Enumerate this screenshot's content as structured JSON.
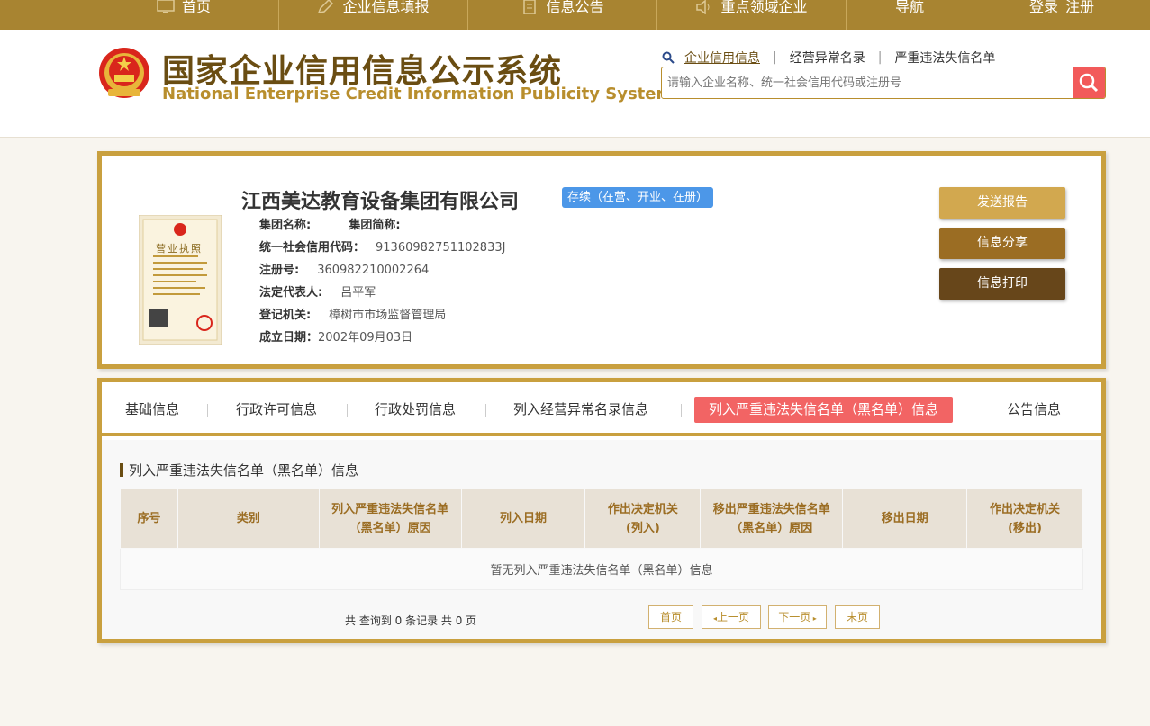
{
  "topnav": {
    "items": [
      {
        "label": "首页",
        "icon": "monitor-icon"
      },
      {
        "label": "企业信息填报",
        "icon": "edit-icon"
      },
      {
        "label": "信息公告",
        "icon": "document-icon"
      },
      {
        "label": "重点领域企业",
        "icon": "speaker-icon"
      },
      {
        "label": "导航",
        "icon": ""
      },
      {
        "label": "登录",
        "icon": ""
      },
      {
        "label": "注册",
        "icon": ""
      }
    ]
  },
  "header": {
    "title_cn": "国家企业信用信息公示系统",
    "title_en": "National Enterprise Credit Information Publicity System",
    "search_tabs": [
      "企业信用信息",
      "经营异常名录",
      "严重违法失信名单"
    ],
    "search_placeholder": "请输入企业名称、统一社会信用代码或注册号"
  },
  "company": {
    "name": "江西美达教育设备集团有限公司",
    "status": "存续（在营、开业、在册）",
    "license_label": "营业执照",
    "fields": [
      {
        "label": "集团名称:",
        "value": "",
        "label2": "集团简称:"
      },
      {
        "label": "统一社会信用代码：",
        "value": "91360982751102833J"
      },
      {
        "label": "注册号:",
        "value": "360982210002264"
      },
      {
        "label": "法定代表人:",
        "value": "吕平军"
      },
      {
        "label": "登记机关:",
        "value": "樟树市市场监督管理局"
      },
      {
        "label": "成立日期：",
        "value": "2002年09月03日"
      }
    ],
    "actions": {
      "send": "发送报告",
      "share": "信息分享",
      "print": "信息打印"
    }
  },
  "tabs": [
    {
      "label": "基础信息",
      "active": false
    },
    {
      "label": "行政许可信息",
      "active": false
    },
    {
      "label": "行政处罚信息",
      "active": false
    },
    {
      "label": "列入经营异常名录信息",
      "active": false
    },
    {
      "label": "列入严重违法失信名单（黑名单）信息",
      "active": true
    },
    {
      "label": "公告信息",
      "active": false
    }
  ],
  "section": {
    "title": "列入严重违法失信名单（黑名单）信息",
    "columns": [
      "序号",
      "类别",
      "列入严重违法失信名单（黑名单）原因",
      "列入日期",
      "作出决定机关(列入)",
      "移出严重违法失信名单（黑名单）原因",
      "移出日期",
      "作出决定机关(移出)"
    ],
    "empty_text": "暂无列入严重违法失信名单（黑名单）信息"
  },
  "pager": {
    "info": "共 查询到 0 条记录 共 0 页",
    "first": "首页",
    "prev": "上一页",
    "next": "下一页",
    "last": "末页"
  },
  "colors": {
    "nav_bg": "#a88431",
    "gold_border": "#c9a03f",
    "status_blue": "#4c97e8",
    "active_tab": "#f26464",
    "search_btn": "#f25a5a"
  }
}
